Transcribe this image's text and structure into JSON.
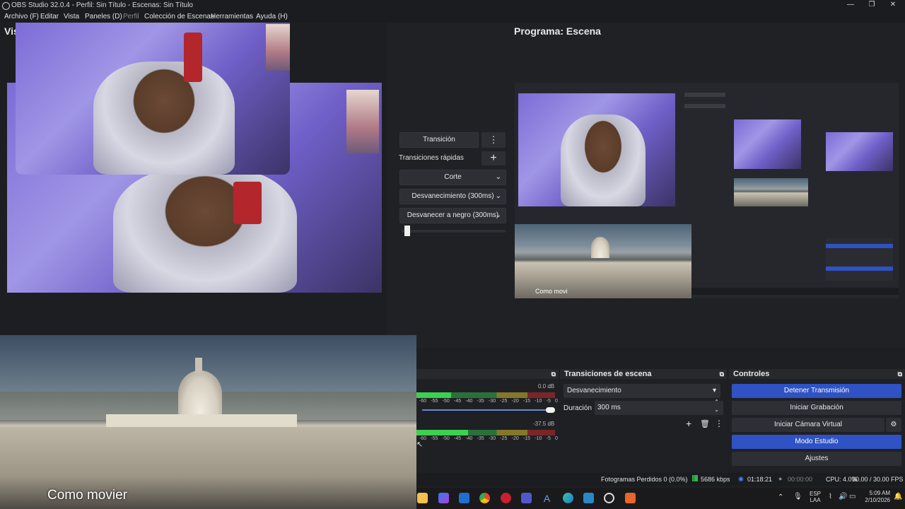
{
  "window": {
    "title": "OBS Studio 32.0.4 - Perfil: Sin Título - Escenas: Sin Título",
    "controls": [
      "—",
      "❐",
      "✕"
    ]
  },
  "menu": {
    "items": [
      "Archivo (F)",
      "Editar",
      "Vista",
      "Paneles (D)",
      "Perfil",
      "Colección de Escenas",
      "Herramientas",
      "Ayuda (H)"
    ]
  },
  "preview": {
    "label": "Vis"
  },
  "program": {
    "title": "Programa: Escena",
    "caption_small": "Como movi"
  },
  "transition": {
    "main_button": "Transición",
    "quick_label": "Transiciones rápidas",
    "options": [
      "Corte",
      "Desvanecimiento (300ms)",
      "Desvanecer a negro (300ms)"
    ],
    "slider_fraction": 0.05
  },
  "overlay": {
    "caption": "Como movier"
  },
  "audio": {
    "tracks": [
      {
        "db": "0.0 dB",
        "level_fraction": 0.25
      },
      {
        "db": "-37.5 dB",
        "level_fraction": 0.37
      }
    ],
    "ticks": [
      "-60",
      "-55",
      "-50",
      "-45",
      "-40",
      "-35",
      "-30",
      "-25",
      "-20",
      "-15",
      "-10",
      "-5",
      "0"
    ]
  },
  "scene_transitions": {
    "title": "Transiciones de escena",
    "selected": "Desvanecimiento",
    "duration_label": "Duración",
    "duration_value": "300 ms"
  },
  "controls": {
    "title": "Controles",
    "buttons": [
      "Detener Transmisión",
      "Iniciar Grabación",
      "Iniciar Cámara Virtual",
      "Modo Estudio",
      "Ajustes"
    ]
  },
  "status": {
    "dropped": "Fotogramas Perdidos 0 (0.0%)",
    "bitrate": "5686 kbps",
    "stream_time": "01:18:21",
    "rec_time": "00:00:00",
    "cpu": "CPU: 4.0%",
    "fps": "30.00 / 30.00 FPS"
  },
  "taskbar": {
    "lang_top": "ESP",
    "lang_bottom": "LAA",
    "time": "5:09 AM",
    "date": "2/10/2026"
  },
  "colors": {
    "accent_blue": "#2f52c4",
    "meter_green": "#3ad24f",
    "meter_yellow": "#d7c12c",
    "meter_red": "#c42b2b"
  }
}
